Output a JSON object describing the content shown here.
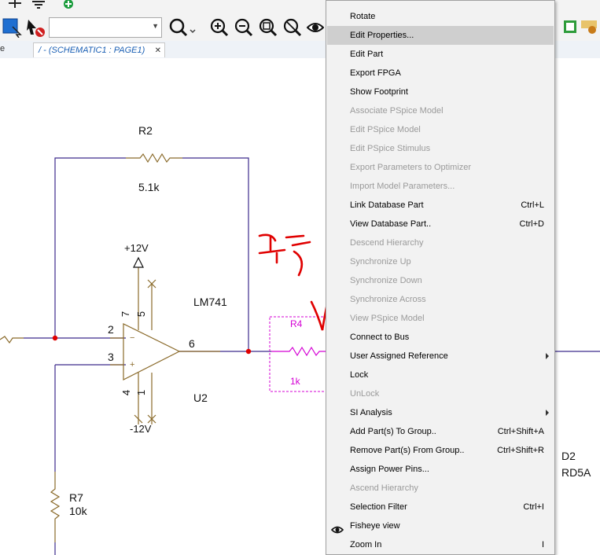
{
  "tab": {
    "label": "/ - (SCHEMATIC1 : PAGE1)",
    "left_fragment": "e",
    "close": "✕"
  },
  "schematic": {
    "labels": {
      "r2_ref": "R2",
      "r2_val": "5.1k",
      "vplus": "+12V",
      "vminus": "-12V",
      "u2_part": "LM741",
      "u2_ref": "U2",
      "pin2": "2",
      "pin3": "3",
      "pin6": "6",
      "pin7": "7",
      "pin5": "5",
      "pin4": "4",
      "pin1": "1",
      "minus_sign": "−",
      "plus_sign": "+",
      "r4_ref": "R4",
      "r4_val": "1k",
      "r7_ref": "R7",
      "r7_val": "10k",
      "d2_ref": "D2",
      "d2_val": "RD5A"
    },
    "colors": {
      "wire": "#3c2a8c",
      "part": "#8a6a2a",
      "selected": "#d400d4",
      "junction": "#e00000",
      "annotation": "#e00000"
    }
  },
  "context_menu": {
    "items": [
      {
        "label": "Rotate",
        "shortcut": "",
        "enabled": true
      },
      {
        "label": "Edit Properties...",
        "shortcut": "",
        "enabled": true,
        "highlighted": true
      },
      {
        "label": "Edit Part",
        "shortcut": "",
        "enabled": true
      },
      {
        "label": "Export FPGA",
        "shortcut": "",
        "enabled": true
      },
      {
        "label": "Show Footprint",
        "shortcut": "",
        "enabled": true
      },
      {
        "label": "Associate PSpice Model",
        "shortcut": "",
        "enabled": false
      },
      {
        "label": "Edit PSpice Model",
        "shortcut": "",
        "enabled": false
      },
      {
        "label": "Edit PSpice Stimulus",
        "shortcut": "",
        "enabled": false
      },
      {
        "label": "Export Parameters to Optimizer",
        "shortcut": "",
        "enabled": false
      },
      {
        "label": "Import Model Parameters...",
        "shortcut": "",
        "enabled": false
      },
      {
        "label": "Link Database Part",
        "shortcut": "Ctrl+L",
        "enabled": true
      },
      {
        "label": "View Database Part..",
        "shortcut": "Ctrl+D",
        "enabled": true
      },
      {
        "label": "Descend Hierarchy",
        "shortcut": "",
        "enabled": false
      },
      {
        "label": "Synchronize Up",
        "shortcut": "",
        "enabled": false
      },
      {
        "label": "Synchronize Down",
        "shortcut": "",
        "enabled": false
      },
      {
        "label": "Synchronize Across",
        "shortcut": "",
        "enabled": false
      },
      {
        "label": "View PSpice Model",
        "shortcut": "",
        "enabled": false
      },
      {
        "label": "Connect to Bus",
        "shortcut": "",
        "enabled": true
      },
      {
        "label": "User Assigned Reference",
        "shortcut": "",
        "enabled": true,
        "submenu": true
      },
      {
        "label": "Lock",
        "shortcut": "",
        "enabled": true
      },
      {
        "label": "UnLock",
        "shortcut": "",
        "enabled": false
      },
      {
        "label": "SI Analysis",
        "shortcut": "",
        "enabled": true,
        "submenu": true
      },
      {
        "label": "Add Part(s) To Group..",
        "shortcut": "Ctrl+Shift+A",
        "enabled": true
      },
      {
        "label": "Remove Part(s) From Group..",
        "shortcut": "Ctrl+Shift+R",
        "enabled": true
      },
      {
        "label": "Assign Power Pins...",
        "shortcut": "",
        "enabled": true
      },
      {
        "label": "Ascend Hierarchy",
        "shortcut": "",
        "enabled": false
      },
      {
        "label": "Selection Filter",
        "shortcut": "Ctrl+I",
        "enabled": true
      },
      {
        "label": "Fisheye view",
        "shortcut": "",
        "enabled": true,
        "icon": "eye-icon"
      },
      {
        "label": "Zoom In",
        "shortcut": "I",
        "enabled": true
      }
    ]
  },
  "toolbar": {
    "combo_value": "",
    "icons": [
      "place-wire-icon",
      "ground-icon",
      "add-icon",
      "select-icon",
      "place-part-icon",
      "search-icon",
      "zoom-in-icon",
      "zoom-out-icon",
      "zoom-area-icon",
      "zoom-fit-icon",
      "eye-icon"
    ]
  }
}
